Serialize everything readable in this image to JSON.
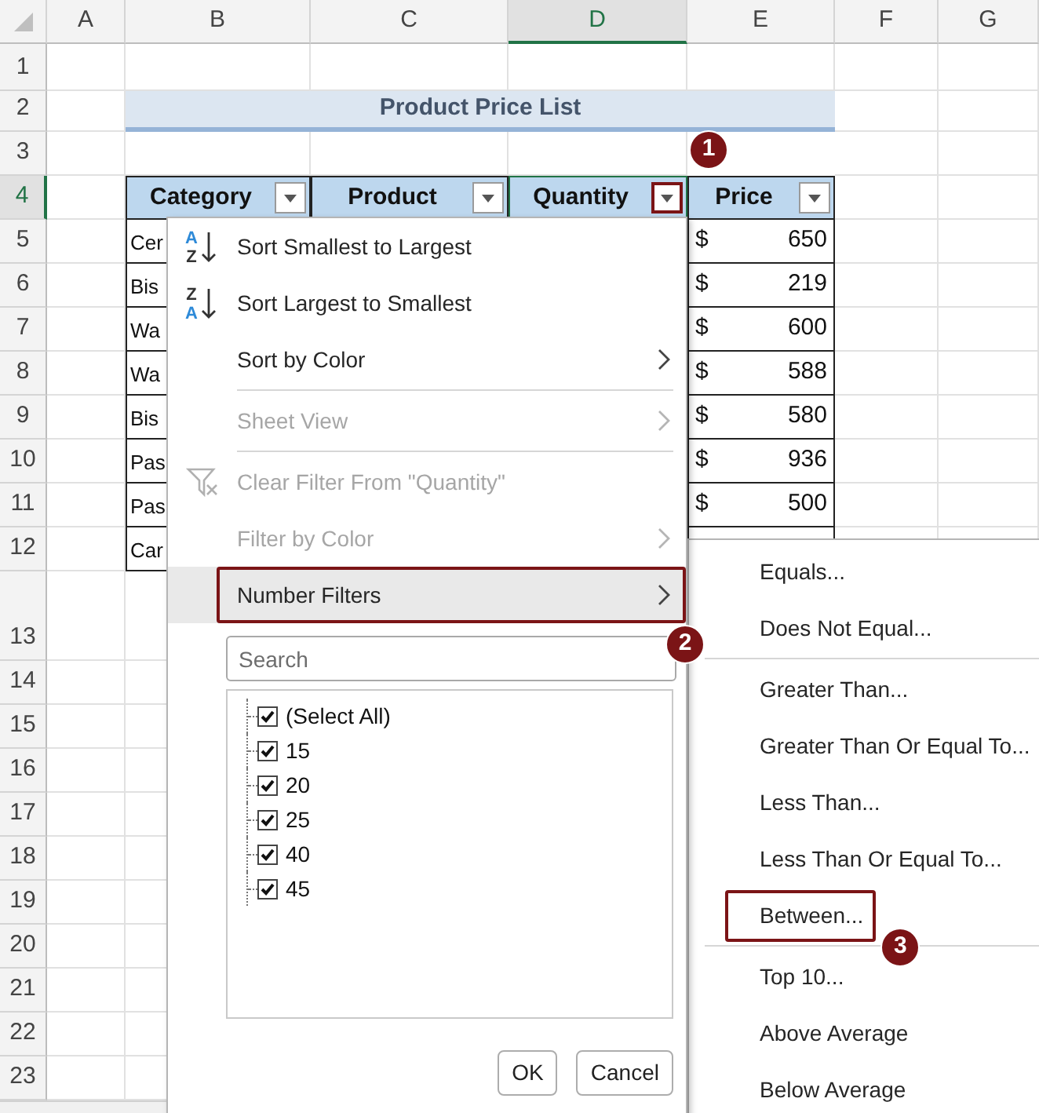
{
  "sheet": {
    "columns": [
      {
        "label": "A",
        "selected": false
      },
      {
        "label": "B",
        "selected": false
      },
      {
        "label": "C",
        "selected": false
      },
      {
        "label": "D",
        "selected": true
      },
      {
        "label": "E",
        "selected": false
      },
      {
        "label": "F",
        "selected": false
      },
      {
        "label": "G",
        "selected": false
      }
    ],
    "rows": [
      {
        "label": "1",
        "selected": false
      },
      {
        "label": "2",
        "selected": false
      },
      {
        "label": "3",
        "selected": false
      },
      {
        "label": "4",
        "selected": true
      },
      {
        "label": "5",
        "selected": false
      },
      {
        "label": "6",
        "selected": false
      },
      {
        "label": "7",
        "selected": false
      },
      {
        "label": "8",
        "selected": false
      },
      {
        "label": "9",
        "selected": false
      },
      {
        "label": "10",
        "selected": false
      },
      {
        "label": "11",
        "selected": false
      },
      {
        "label": "12",
        "selected": false
      },
      {
        "label": "13",
        "selected": false
      },
      {
        "label": "14",
        "selected": false
      },
      {
        "label": "15",
        "selected": false
      },
      {
        "label": "16",
        "selected": false
      },
      {
        "label": "17",
        "selected": false
      },
      {
        "label": "18",
        "selected": false
      },
      {
        "label": "19",
        "selected": false
      },
      {
        "label": "20",
        "selected": false
      },
      {
        "label": "21",
        "selected": false
      },
      {
        "label": "22",
        "selected": false
      },
      {
        "label": "23",
        "selected": false
      }
    ]
  },
  "title": "Product Price List",
  "table": {
    "headers": [
      {
        "label": "Category",
        "highlighted": false
      },
      {
        "label": "Product",
        "highlighted": false
      },
      {
        "label": "Quantity",
        "highlighted": true,
        "callout": "1"
      },
      {
        "label": "Price",
        "highlighted": false
      }
    ],
    "rows": [
      {
        "category": "Cer",
        "currency": "$",
        "price": "650"
      },
      {
        "category": "Bis",
        "currency": "$",
        "price": "219"
      },
      {
        "category": "Wa",
        "currency": "$",
        "price": "600"
      },
      {
        "category": "Wa",
        "currency": "$",
        "price": "588"
      },
      {
        "category": "Bis",
        "currency": "$",
        "price": "580"
      },
      {
        "category": "Pas",
        "currency": "$",
        "price": "936"
      },
      {
        "category": "Pas",
        "currency": "$",
        "price": "500"
      },
      {
        "category": "Car"
      }
    ]
  },
  "filter_menu": {
    "items": [
      {
        "kind": "sort-ascending",
        "icon_text": [
          "A",
          "Z"
        ],
        "label": "Sort Smallest to Largest",
        "disabled": false,
        "highlighted": false
      },
      {
        "kind": "sort-descending",
        "icon_text": [
          "Z",
          "A"
        ],
        "label": "Sort Largest to Smallest",
        "disabled": false,
        "highlighted": false
      },
      {
        "kind": "submenu",
        "label": "Sort by Color",
        "disabled": false,
        "highlighted": false
      },
      {
        "kind": "separator"
      },
      {
        "kind": "submenu",
        "label": "Sheet View",
        "disabled": true,
        "highlighted": false
      },
      {
        "kind": "separator"
      },
      {
        "kind": "clear",
        "label": "Clear Filter From \"Quantity\"",
        "disabled": true,
        "highlighted": false
      },
      {
        "kind": "submenu",
        "label": "Filter by Color",
        "disabled": true,
        "highlighted": false
      },
      {
        "kind": "submenu",
        "label": "Number Filters",
        "disabled": false,
        "highlighted": true,
        "callout": "2"
      }
    ],
    "search": {
      "placeholder": "Search"
    },
    "values": [
      {
        "label": "(Select All)",
        "checked": true
      },
      {
        "label": "15",
        "checked": true
      },
      {
        "label": "20",
        "checked": true
      },
      {
        "label": "25",
        "checked": true
      },
      {
        "label": "40",
        "checked": true
      },
      {
        "label": "45",
        "checked": true
      }
    ],
    "buttons": [
      "OK",
      "Cancel"
    ]
  },
  "number_filters_menu": {
    "items": [
      {
        "kind": "item",
        "label": "Equals...",
        "highlighted": false
      },
      {
        "kind": "item",
        "label": "Does Not Equal...",
        "highlighted": false
      },
      {
        "kind": "separator"
      },
      {
        "kind": "item",
        "label": "Greater Than...",
        "highlighted": false
      },
      {
        "kind": "item",
        "label": "Greater Than Or Equal To...",
        "highlighted": false
      },
      {
        "kind": "item",
        "label": "Less Than...",
        "highlighted": false
      },
      {
        "kind": "item",
        "label": "Less Than Or Equal To...",
        "highlighted": false
      },
      {
        "kind": "item",
        "label": "Between...",
        "highlighted": true,
        "callout": "3"
      },
      {
        "kind": "separator"
      },
      {
        "kind": "item",
        "label": "Top 10...",
        "highlighted": false
      },
      {
        "kind": "item",
        "label": "Above Average",
        "highlighted": false
      },
      {
        "kind": "item",
        "label": "Below Average",
        "highlighted": false
      }
    ]
  }
}
